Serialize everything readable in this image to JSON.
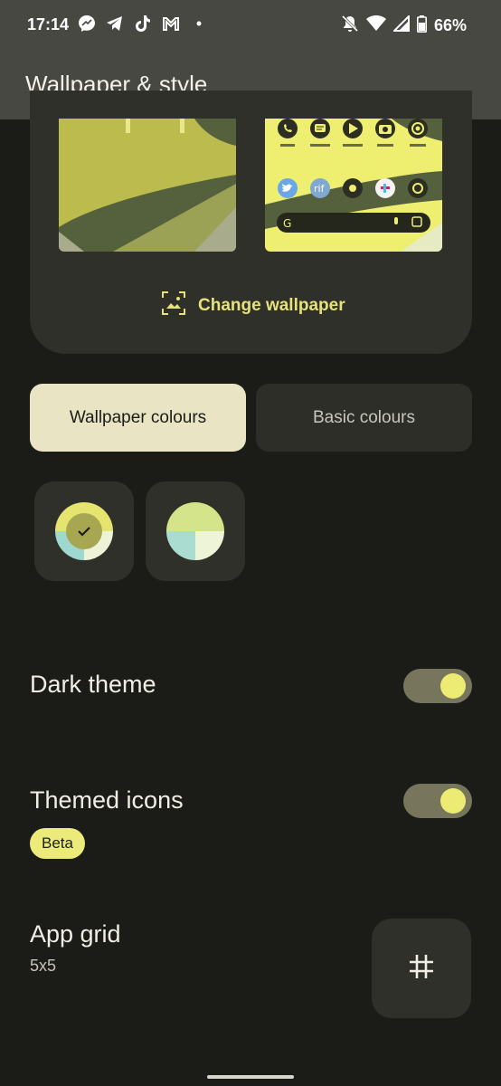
{
  "status_bar": {
    "time": "17:14",
    "battery": "66%",
    "dot": "•"
  },
  "app_bar": {
    "title": "Wallpaper & style"
  },
  "preview": {
    "change_wallpaper_label": "Change wallpaper",
    "home_app_icons_row1": [
      "phone-icon",
      "messages-icon",
      "play-store-icon",
      "camera-icon",
      "chrome-icon"
    ],
    "home_app_icons_row2": [
      "twitter-icon",
      "rif-icon",
      "app-icon",
      "slack-icon",
      "app-icon"
    ],
    "home_icon_text": "rif",
    "search_logo": "G"
  },
  "colour_tabs": {
    "wallpaper_colours": "Wallpaper colours",
    "basic_colours": "Basic colours"
  },
  "colour_options": [
    {
      "colors": [
        "#e4e46e",
        "#9fd8cf",
        "#eef2d6",
        "#a7a752"
      ],
      "selected": true
    },
    {
      "colors": [
        "#d3e48a",
        "#aadcd1",
        "#eef4d7"
      ],
      "selected": false
    }
  ],
  "settings": {
    "dark_theme": {
      "label": "Dark theme",
      "on": true
    },
    "themed_icons": {
      "label": "Themed icons",
      "badge": "Beta",
      "on": true
    },
    "app_grid": {
      "label": "App grid",
      "value": "5x5"
    }
  },
  "colors": {
    "accent": "#e6e27a",
    "background": "#1b1c17",
    "app_bar": "#474842",
    "card": "#2f302a"
  }
}
